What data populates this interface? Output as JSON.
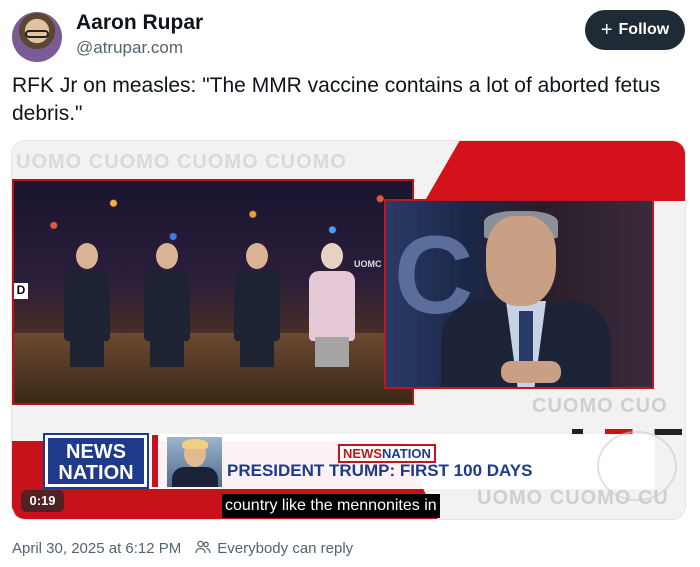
{
  "author": {
    "name": "Aaron Rupar",
    "handle": "@atrupar.com"
  },
  "follow_label": "Follow",
  "post": {
    "text": "RFK Jr on measles: \"The MMR vaccine contains a lot of aborted fetus debris.\""
  },
  "video": {
    "background_text_top": "UOMO CUOMO CUOMO CUOMO",
    "background_text_mid": "CUOMO CUO",
    "background_text_low": "UOMO CUOMO CU",
    "studio_sign": "UOMC",
    "channel_logo_line1": "NEWS",
    "channel_logo_line2": "NATION",
    "tag_news": "NEWS",
    "tag_nation": "NATION",
    "headline": "PRESIDENT TRUMP: FIRST 100 DAYS",
    "timer": "0:19",
    "caption": "country like the mennonites in"
  },
  "footer": {
    "timestamp": "April 30, 2025 at 6:12 PM",
    "reply_setting": "Everybody can reply"
  },
  "colors": {
    "follow_bg": "#1f2a37",
    "brand_blue": "#1d3b8a",
    "brand_red": "#c8121b",
    "muted": "#536471"
  },
  "icons": [
    "plus-icon",
    "people-icon"
  ]
}
